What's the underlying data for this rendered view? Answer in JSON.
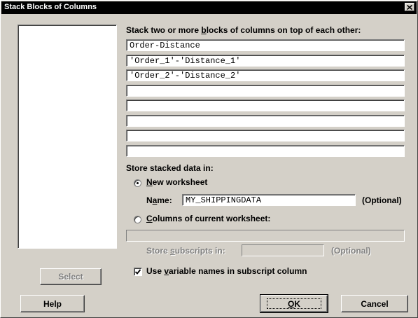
{
  "window": {
    "title": "Stack Blocks of Columns",
    "close_glyph": "✕"
  },
  "instructions": {
    "pre": "Stack two or more ",
    "accel": "b",
    "post": "locks of columns on top of each other:"
  },
  "blocks": [
    "Order-Distance",
    "'Order_1'-'Distance_1'",
    "'Order_2'-'Distance_2'",
    "",
    "",
    "",
    "",
    ""
  ],
  "store": {
    "heading": "Store stacked data in:",
    "new_worksheet": {
      "accel": "N",
      "rest": "ew worksheet",
      "selected": true
    },
    "name_label": {
      "pre": "N",
      "accel": "a",
      "post": "me:"
    },
    "name_value": "MY_SHIPPINGDATA",
    "optional": "(Optional)",
    "columns_current": {
      "accel": "C",
      "rest": "olumns of current worksheet:",
      "selected": false
    },
    "columns_value": "",
    "subscripts_label": {
      "pre": "Store ",
      "accel": "s",
      "post": "ubscripts in:"
    },
    "subscripts_value": "",
    "subscripts_optional": "(Optional)"
  },
  "use_names": {
    "pre": "Use ",
    "accel": "v",
    "post": "ariable names in subscript column",
    "checked": true
  },
  "buttons": {
    "select": "Select",
    "help": "Help",
    "ok_accel": "O",
    "ok_rest": "K",
    "cancel": "Cancel"
  }
}
